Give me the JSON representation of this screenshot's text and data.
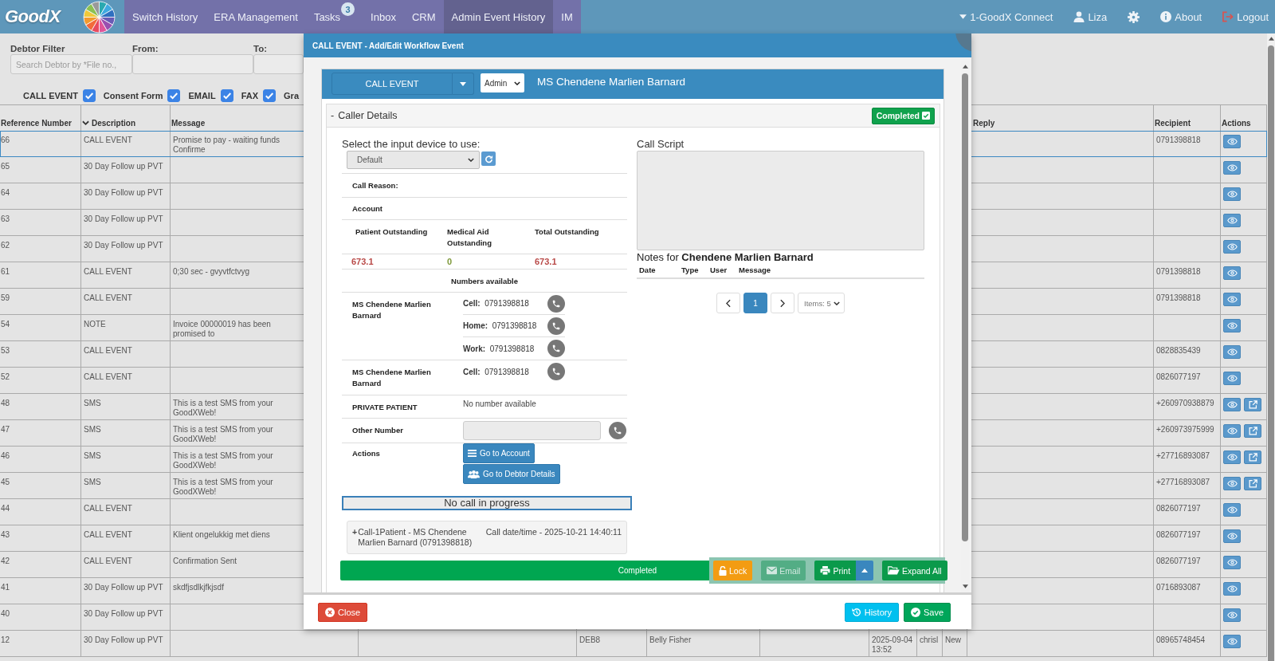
{
  "nav": {
    "logo": "GoodX",
    "items": [
      {
        "label": "Switch History",
        "selected": false
      },
      {
        "label": "ERA Management",
        "selected": false
      },
      {
        "label": "Tasks",
        "selected": false,
        "badge": "3"
      },
      {
        "label": "Inbox",
        "selected": false
      },
      {
        "label": "CRM",
        "selected": false
      },
      {
        "label": "Admin Event History",
        "selected": true
      },
      {
        "label": "IM",
        "selected": false
      }
    ],
    "right": [
      {
        "kind": "practice",
        "label": "1-GoodX Connect"
      },
      {
        "kind": "user",
        "label": "Liza"
      },
      {
        "kind": "settings"
      },
      {
        "kind": "about",
        "label": "About"
      },
      {
        "kind": "logout",
        "label": "Logout"
      }
    ]
  },
  "filters": {
    "fields": [
      {
        "label": "Debtor Filter",
        "placeholder": "Search Debtor by *File no.,"
      },
      {
        "label": "From:"
      },
      {
        "label": "To:"
      }
    ],
    "types": [
      {
        "label": "CALL EVENT",
        "checked": true
      },
      {
        "label": "Consent Form",
        "checked": true
      },
      {
        "label": "EMAIL",
        "checked": true
      },
      {
        "label": "FAX",
        "checked": true
      },
      {
        "label": "Gra"
      }
    ]
  },
  "table": {
    "columns": [
      {
        "label": "Reference Number",
        "sorted": false
      },
      {
        "label": "Description",
        "sorted": true
      },
      {
        "label": "Message",
        "sorted": false
      },
      {
        "label": "Reply",
        "sorted": false
      },
      {
        "label": "Recipient",
        "sorted": false
      },
      {
        "label": "Actions",
        "sorted": false
      }
    ],
    "rows": [
      {
        "ref": "66",
        "description": "CALL EVENT",
        "message": "Promise to pay - waiting funds Confirme",
        "recipient": "0791398818",
        "selected": true,
        "share": false
      },
      {
        "ref": "65",
        "description": "30 Day Follow up PVT",
        "selected": false,
        "share": false
      },
      {
        "ref": "64",
        "description": "30 Day Follow up PVT",
        "selected": false,
        "share": false
      },
      {
        "ref": "63",
        "description": "30 Day Follow up PVT",
        "selected": false,
        "share": false
      },
      {
        "ref": "62",
        "description": "30 Day Follow up PVT",
        "selected": false,
        "share": false
      },
      {
        "ref": "61",
        "description": "CALL EVENT",
        "message": "0;30 sec - gvyvtfctvyg",
        "recipient": "0791398818",
        "selected": false,
        "share": false
      },
      {
        "ref": "59",
        "description": "CALL EVENT",
        "recipient": "0791398818",
        "selected": false,
        "share": false
      },
      {
        "ref": "54",
        "description": "NOTE",
        "message": "Invoice 00000019 has been promised to",
        "selected": false,
        "share": false
      },
      {
        "ref": "53",
        "description": "CALL EVENT",
        "recipient": "0828835439",
        "selected": false,
        "share": false
      },
      {
        "ref": "52",
        "description": "CALL EVENT",
        "recipient": "0826077197",
        "selected": false,
        "share": false
      },
      {
        "ref": "48",
        "description": "SMS",
        "message": "This is a test SMS from your GoodXWeb!",
        "recipient": "+260970938879",
        "selected": false,
        "share": true
      },
      {
        "ref": "47",
        "description": "SMS",
        "message": "This is a test SMS from your GoodXWeb!",
        "recipient": "+260973975999",
        "selected": false,
        "share": true
      },
      {
        "ref": "46",
        "description": "SMS",
        "message": "This is a test SMS from your GoodXWeb!",
        "recipient": "+27716893087",
        "selected": false,
        "share": true
      },
      {
        "ref": "45",
        "description": "SMS",
        "message": "This is a test SMS from your GoodXWeb!",
        "recipient": "+27716893087",
        "selected": false,
        "share": true
      },
      {
        "ref": "44",
        "description": "CALL EVENT",
        "recipient": "0826077197",
        "selected": false,
        "share": false
      },
      {
        "ref": "43",
        "description": "CALL EVENT",
        "message": "Klient ongelukkig met diens",
        "recipient": "0826077197",
        "selected": false,
        "share": false
      },
      {
        "ref": "42",
        "description": "CALL EVENT",
        "message": "Confirmation Sent",
        "recipient": "0826077197",
        "selected": false,
        "share": false
      },
      {
        "ref": "41",
        "description": "30 Day Follow up PVT",
        "message": "skdfjsdlkjfkjsdf",
        "recipient": "0716893087",
        "selected": false,
        "share": false
      },
      {
        "ref": "40",
        "description": "30 Day Follow up PVT",
        "selected": false,
        "share": false
      },
      {
        "ref": "12",
        "description": "30 Day Follow up PVT",
        "column_5": "DEB8",
        "column_6": "Belly Fisher",
        "column_8": "2025-09-04 13:52",
        "column_9": "chrisl",
        "column_10": "New",
        "recipient": "08965748454",
        "selected": false,
        "share": false
      }
    ]
  },
  "modal": {
    "title": "CALL EVENT - Add/Edit Workflow Event",
    "event_type": "CALL EVENT",
    "role": "Admin",
    "patient": "MS Chendene Marlien Barnard",
    "section": {
      "toggle": "-",
      "title": "Caller Details",
      "status": "Completed",
      "checked": true
    },
    "device": {
      "label": "Select the input device to use:",
      "value": "Default"
    },
    "call_reason": "Call Reason:",
    "account": {
      "title": "Account",
      "columns": [
        "Patient Outstanding",
        "Medical Aid Outstanding",
        "Total Outstanding"
      ],
      "values": [
        {
          "text": "673.1",
          "color": "#b94a48"
        },
        {
          "text": "0",
          "color": "#7f9a3c"
        },
        {
          "text": "673.1",
          "color": "#b94a48"
        }
      ]
    },
    "numbers": {
      "title": "Numbers available",
      "contacts": [
        {
          "name": "MS Chendene Marlien Barnard",
          "phones": [
            {
              "type": "Cell:",
              "number": "0791398818"
            },
            {
              "type": "Home:",
              "number": "0791398818"
            },
            {
              "type": "Work:",
              "number": "0791398818"
            }
          ]
        },
        {
          "name": "MS Chendene Marlien Barnard",
          "phones": [
            {
              "type": "Cell:",
              "number": "0791398818"
            }
          ]
        },
        {
          "name": "PRIVATE PATIENT",
          "empty": "No number available"
        }
      ]
    },
    "other_number": {
      "label": "Other Number"
    },
    "actions": {
      "label": "Actions",
      "buttons": [
        {
          "kind": "account",
          "label": "Go to Account"
        },
        {
          "kind": "debtor",
          "label": "Go to Debtor Details"
        }
      ]
    },
    "call_status": "No call in progress",
    "calls": [
      {
        "toggle": "+",
        "title": "Call-1Patient - MS Chendene Marlien Barnard (0791398818)",
        "datetime": "Call date/time - 2025-10-21 14:40:11"
      }
    ],
    "status_bar": "Completed",
    "toolbar": [
      {
        "kind": "lock",
        "label": "Lock",
        "disabled": false,
        "dropdown": false
      },
      {
        "kind": "email",
        "label": "Email",
        "disabled": true,
        "dropdown": false
      },
      {
        "kind": "print",
        "label": "Print",
        "disabled": false,
        "dropdown": true
      },
      {
        "kind": "expand",
        "label": "Expand All",
        "disabled": false,
        "dropdown": false
      }
    ],
    "script": {
      "title": "Call Script"
    },
    "notes": {
      "title": "Notes for **Chendene Marlien Barnard**",
      "columns": [
        "Date",
        "Type",
        "User",
        "Message"
      ],
      "pages": [
        {
          "label": "1",
          "selected": true
        }
      ],
      "page_size": "Items: 5"
    },
    "footer": [
      {
        "kind": "close",
        "label": "Close"
      },
      {
        "kind": "history",
        "label": "History"
      },
      {
        "kind": "save",
        "label": "Save"
      }
    ]
  }
}
